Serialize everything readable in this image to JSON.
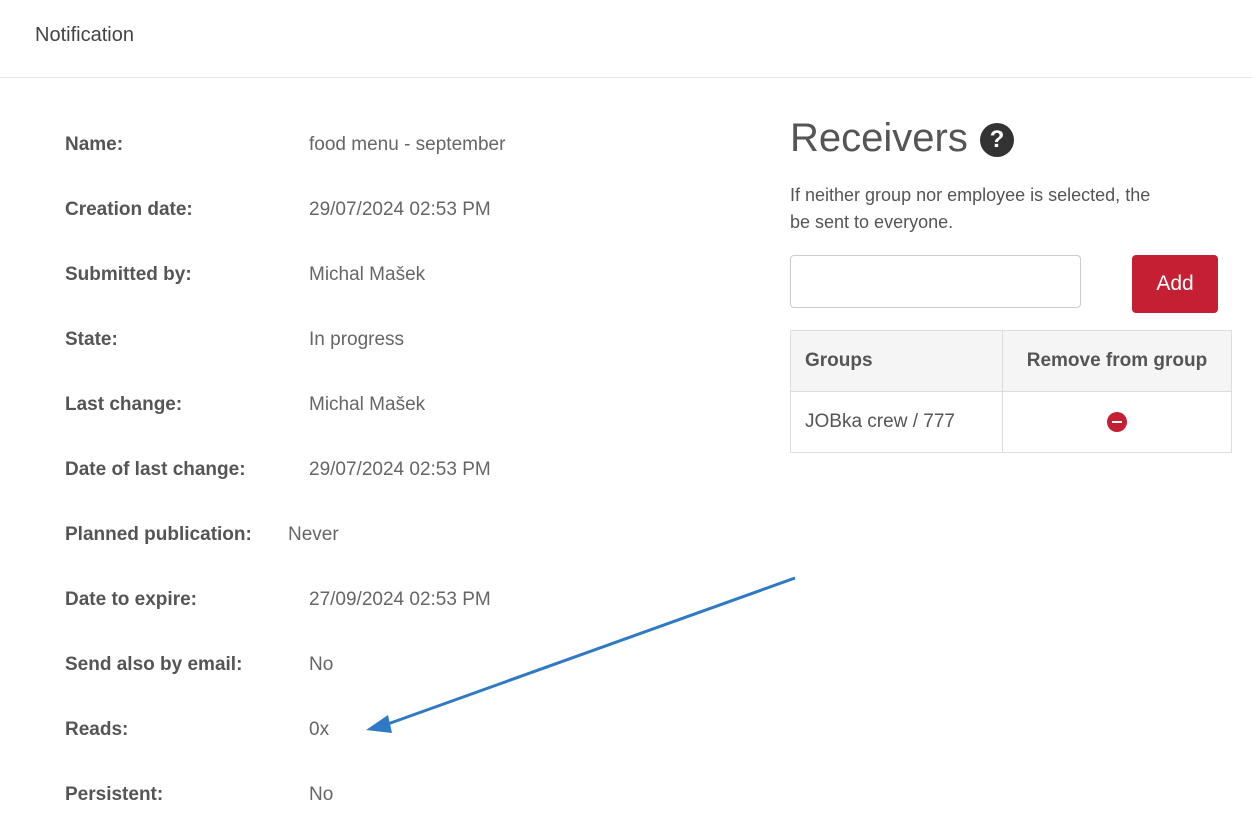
{
  "header": {
    "title": "Notification"
  },
  "details": [
    {
      "label": "Name:",
      "value": "food menu - september"
    },
    {
      "label": "Creation date:",
      "value": "29/07/2024 02:53 PM"
    },
    {
      "label": "Submitted by:",
      "value": "Michal Mašek"
    },
    {
      "label": "State:",
      "value": "In progress"
    },
    {
      "label": "Last change:",
      "value": "Michal Mašek"
    },
    {
      "label": "Date of last change:",
      "value": "29/07/2024 02:53 PM"
    },
    {
      "label": "Planned publication:",
      "value": "Never"
    },
    {
      "label": "Date to expire:",
      "value": "27/09/2024 02:53 PM"
    },
    {
      "label": "Send also by email:",
      "value": "No"
    },
    {
      "label": "Reads:",
      "value": "0x"
    },
    {
      "label": "Persistent:",
      "value": "No"
    }
  ],
  "receivers": {
    "title": "Receivers",
    "note": "If neither group nor employee is selected, the\nbe sent to everyone.",
    "add_label": "Add",
    "input_value": "",
    "table": {
      "headers": [
        "Groups",
        "Remove from group"
      ],
      "rows": [
        {
          "group": "JOBka crew / 777"
        }
      ]
    }
  },
  "colors": {
    "accent": "#c41f33",
    "annotation_arrow": "#2f7ac4"
  },
  "icons": {
    "help": "question-circle-icon",
    "remove": "minus-circle-icon"
  }
}
